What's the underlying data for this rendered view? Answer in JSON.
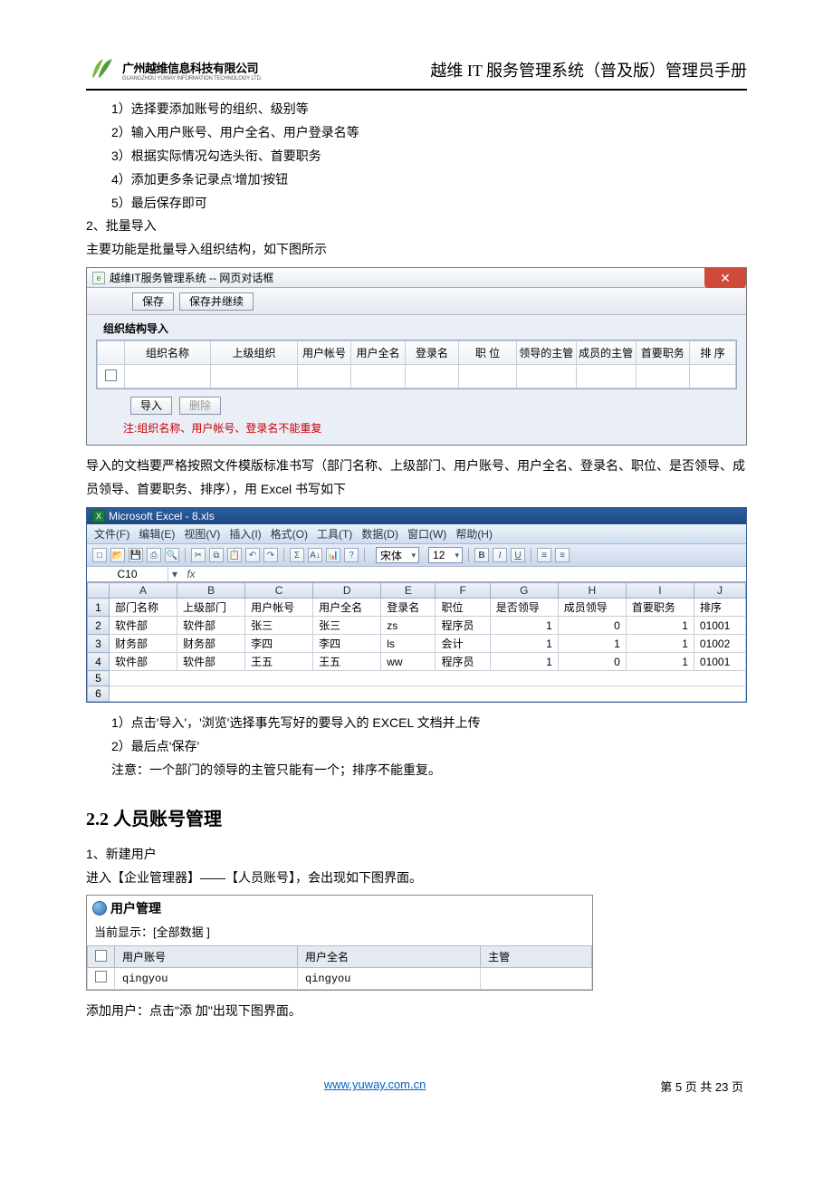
{
  "header": {
    "logo_cn": "广州越维信息科技有限公司",
    "logo_en": "GUANGZHOU YUWAY INFORMATION TECHNOLOGY LTD.",
    "doc_title": "越维 IT 服务管理系统（普及版）管理员手册"
  },
  "steps_a": [
    "1）选择要添加账号的组织、级别等",
    "2）输入用户账号、用户全名、用户登录名等",
    "3）根据实际情况勾选头衔、首要职务",
    "4）添加更多条记录点'增加'按钮",
    "5）最后保存即可"
  ],
  "section2_title": "2、批量导入",
  "section2_desc": "主要功能是批量导入组织结构，如下图所示",
  "dialog1": {
    "title": "越维IT服务管理系统 -- 网页对话框",
    "btn_save": "保存",
    "btn_save_continue": "保存并继续",
    "section_label": "组织结构导入",
    "cols": [
      "",
      "组织名称",
      "上级组织",
      "用户帐号",
      "用户全名",
      "登录名",
      "职 位",
      "领导的主管",
      "成员的主管",
      "首要职务",
      "排 序"
    ],
    "btn_import": "导入",
    "btn_delete": "删除",
    "note": "注:组织名称、用户帐号、登录名不能重复"
  },
  "after_dialog_p": "导入的文档要严格按照文件模版标准书写（部门名称、上级部门、用户账号、用户全名、登录名、职位、是否领导、成员领导、首要职务、排序），用 Excel 书写如下",
  "excel": {
    "title": "Microsoft Excel - 8.xls",
    "menus": [
      "文件(F)",
      "编辑(E)",
      "视图(V)",
      "插入(I)",
      "格式(O)",
      "工具(T)",
      "数据(D)",
      "窗口(W)",
      "帮助(H)"
    ],
    "font_name": "宋体",
    "font_size": "12",
    "cell_ref": "C10",
    "col_letters": [
      "A",
      "B",
      "C",
      "D",
      "E",
      "F",
      "G",
      "H",
      "I",
      "J"
    ],
    "header_row": [
      "部门名称",
      "上级部门",
      "用户帐号",
      "用户全名",
      "登录名",
      "职位",
      "是否领导",
      "成员领导",
      "首要职务",
      "排序"
    ],
    "rows": [
      [
        "软件部",
        "软件部",
        "张三",
        "张三",
        "zs",
        "程序员",
        "1",
        "0",
        "1",
        "01001"
      ],
      [
        "财务部",
        "财务部",
        "李四",
        "李四",
        "ls",
        "会计",
        "1",
        "1",
        "1",
        "01002"
      ],
      [
        "软件部",
        "软件部",
        "王五",
        "王五",
        "ww",
        "程序员",
        "1",
        "0",
        "1",
        "01001"
      ]
    ]
  },
  "steps_b": [
    "1）点击'导入'，'浏览'选择事先写好的要导入的 EXCEL 文档并上传",
    "2）最后点'保存'",
    "注意：一个部门的领导的主管只能有一个；排序不能重复。"
  ],
  "section_22": "2.2 人员账号管理",
  "sec22_line1": "1、新建用户",
  "sec22_line2": "进入【企业管理器】——【人员账号】，会出现如下图界面。",
  "user_mgmt": {
    "title": "用户管理",
    "filter_label": "当前显示：",
    "filter_value": "[全部数据 ]",
    "cols": [
      "",
      "用户账号",
      "用户全名",
      "主管"
    ],
    "row": [
      "",
      "qingyou",
      "qingyou",
      ""
    ]
  },
  "after_um": "添加用户：点击\"添 加\"出现下图界面。",
  "footer": {
    "url": "www.yuway.com.cn",
    "page": "第 5 页 共 23 页"
  }
}
